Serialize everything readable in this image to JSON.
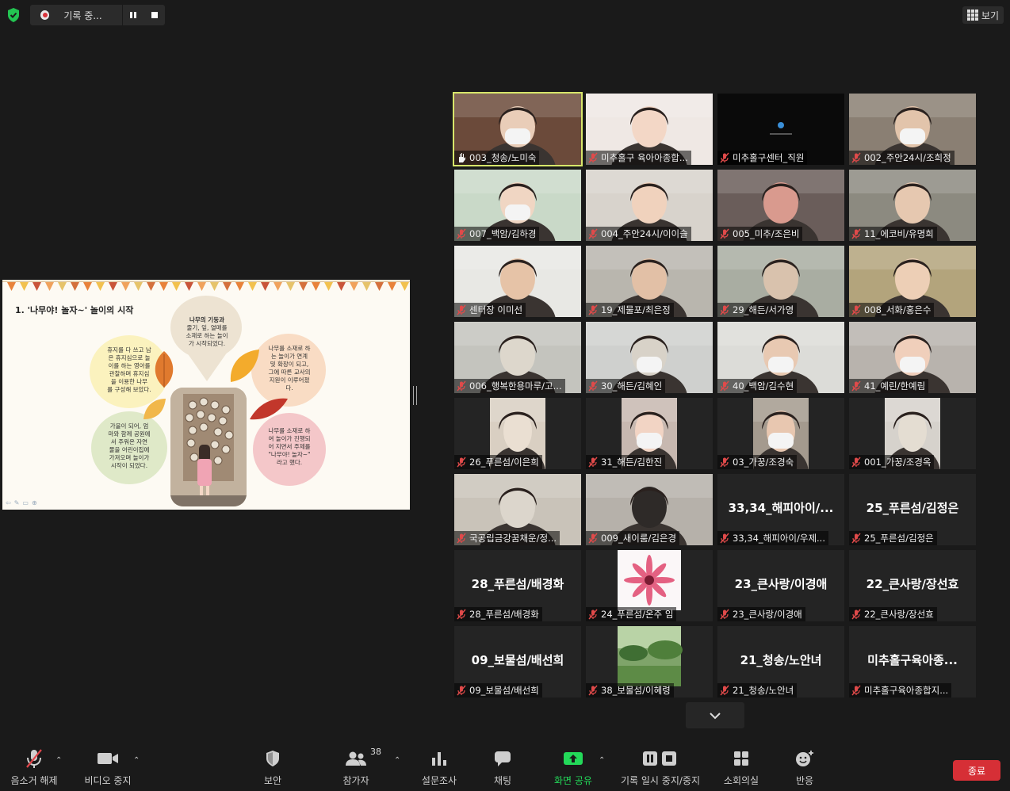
{
  "recording": {
    "status": "기록 중..."
  },
  "view_button": {
    "label": "보기"
  },
  "slide": {
    "title": "1. '나무야! 놀자~' 놀이의 시작",
    "top_bubble": [
      "나무의 기둥과",
      "줄기, 잎, 열매를",
      "소재로 하는 놀이",
      "가 시작되었다."
    ],
    "left_top_bubble": [
      "휴지를 다 쓰고 남",
      "은 휴지심으로 놀",
      "이를 하는 영아를",
      "관찰하며 휴지심",
      "을 이용한 나무",
      "를 구성해 보았다."
    ],
    "left_bottom_bubble": [
      "가을이 되어, 엄",
      "마와 함께 공원에",
      "서 주워온 자연",
      "물을 어린이집에",
      "가져오며 놀이가",
      "시작이 되었다."
    ],
    "right_top_bubble": [
      "나무를 소재로 하",
      "는 놀이가 연계",
      "및 확장이 되고,",
      "그에 따른 교사의",
      "지원이 이루어졌",
      "다."
    ],
    "right_bottom_bubble": [
      "나무를 소재로 하",
      "여 놀이가 진행되",
      "어 지면서 주제를",
      "\"나무야! 놀자~\"",
      "라고 했다."
    ]
  },
  "participants": [
    {
      "label": "003_청송/노미숙",
      "name_display": "",
      "active": true,
      "mic": "hand"
    },
    {
      "label": "미추홀구 육아아종합...",
      "name_display": "",
      "active": false,
      "mic": "off"
    },
    {
      "label": "미추홀구센터_직원",
      "name_display": "",
      "active": false,
      "mic": "off"
    },
    {
      "label": "002_주안24시/조희정",
      "name_display": "",
      "active": false,
      "mic": "off"
    },
    {
      "label": "007_백암/김하경",
      "name_display": "",
      "active": false,
      "mic": "off"
    },
    {
      "label": "004_주안24시/이이슬",
      "name_display": "",
      "active": false,
      "mic": "off"
    },
    {
      "label": "005_미추/조은비",
      "name_display": "",
      "active": false,
      "mic": "off"
    },
    {
      "label": "11_에코비/유명희",
      "name_display": "",
      "active": false,
      "mic": "off"
    },
    {
      "label": "센터장 이미선",
      "name_display": "",
      "active": false,
      "mic": "off"
    },
    {
      "label": "19_제물포/최은정",
      "name_display": "",
      "active": false,
      "mic": "off"
    },
    {
      "label": "29_해든/서가영",
      "name_display": "",
      "active": false,
      "mic": "off"
    },
    {
      "label": "008_서화/홍은수",
      "name_display": "",
      "active": false,
      "mic": "off"
    },
    {
      "label": "006_행복한용마루/고...",
      "name_display": "",
      "active": false,
      "mic": "off"
    },
    {
      "label": "30_해든/김혜인",
      "name_display": "",
      "active": false,
      "mic": "off"
    },
    {
      "label": "40_백암/김수현",
      "name_display": "",
      "active": false,
      "mic": "off"
    },
    {
      "label": "41_예린/한예림",
      "name_display": "",
      "active": false,
      "mic": "off"
    },
    {
      "label": "26_푸른섬/이은희",
      "name_display": "",
      "active": false,
      "mic": "off"
    },
    {
      "label": "31_해든/김한진",
      "name_display": "",
      "active": false,
      "mic": "off"
    },
    {
      "label": "03_가꿍/조경숙",
      "name_display": "",
      "active": false,
      "mic": "off"
    },
    {
      "label": "001_가꿍/조경옥",
      "name_display": "",
      "active": false,
      "mic": "off"
    },
    {
      "label": "국공립금강꿈채운/정...",
      "name_display": "",
      "active": false,
      "mic": "off"
    },
    {
      "label": "009_새이룸/김은경",
      "name_display": "",
      "active": false,
      "mic": "off"
    },
    {
      "label": "33,34_해피아이/우제...",
      "name_display": "33,34_해피아이/...",
      "active": false,
      "mic": "off"
    },
    {
      "label": "25_푸른섬/김정은",
      "name_display": "25_푸른섬/김정은",
      "active": false,
      "mic": "off"
    },
    {
      "label": "28_푸른섬/배경화",
      "name_display": "28_푸른섬/배경화",
      "active": false,
      "mic": "off"
    },
    {
      "label": "24_푸른섬/온주 임",
      "name_display": "",
      "active": false,
      "mic": "off"
    },
    {
      "label": "23_큰사랑/이경애",
      "name_display": "23_큰사랑/이경애",
      "active": false,
      "mic": "off"
    },
    {
      "label": "22_큰사랑/장선효",
      "name_display": "22_큰사랑/장선효",
      "active": false,
      "mic": "off"
    },
    {
      "label": "09_보물섬/배선희",
      "name_display": "09_보물섬/배선희",
      "active": false,
      "mic": "off"
    },
    {
      "label": "38_보물섬/이혜령",
      "name_display": "",
      "active": false,
      "mic": "off"
    },
    {
      "label": "21_청송/노안녀",
      "name_display": "21_청송/노안녀",
      "active": false,
      "mic": "off"
    },
    {
      "label": "미추홀구육아종합지...",
      "name_display": "미추홀구육아종...",
      "active": false,
      "mic": "off"
    }
  ],
  "toolbar": {
    "unmute": "음소거 해제",
    "video": "비디오 중지",
    "security": "보안",
    "participants": "참가자",
    "participants_count": "38",
    "polls": "설문조사",
    "chat": "채팅",
    "share": "화면 공유",
    "record": "기록 일시 중지/중지",
    "breakout": "소회의실",
    "reactions": "반응",
    "end": "종료"
  },
  "colors": {
    "accent_green": "#23d959",
    "end_red": "#d62f36",
    "active_outline": "#d7e66a"
  }
}
